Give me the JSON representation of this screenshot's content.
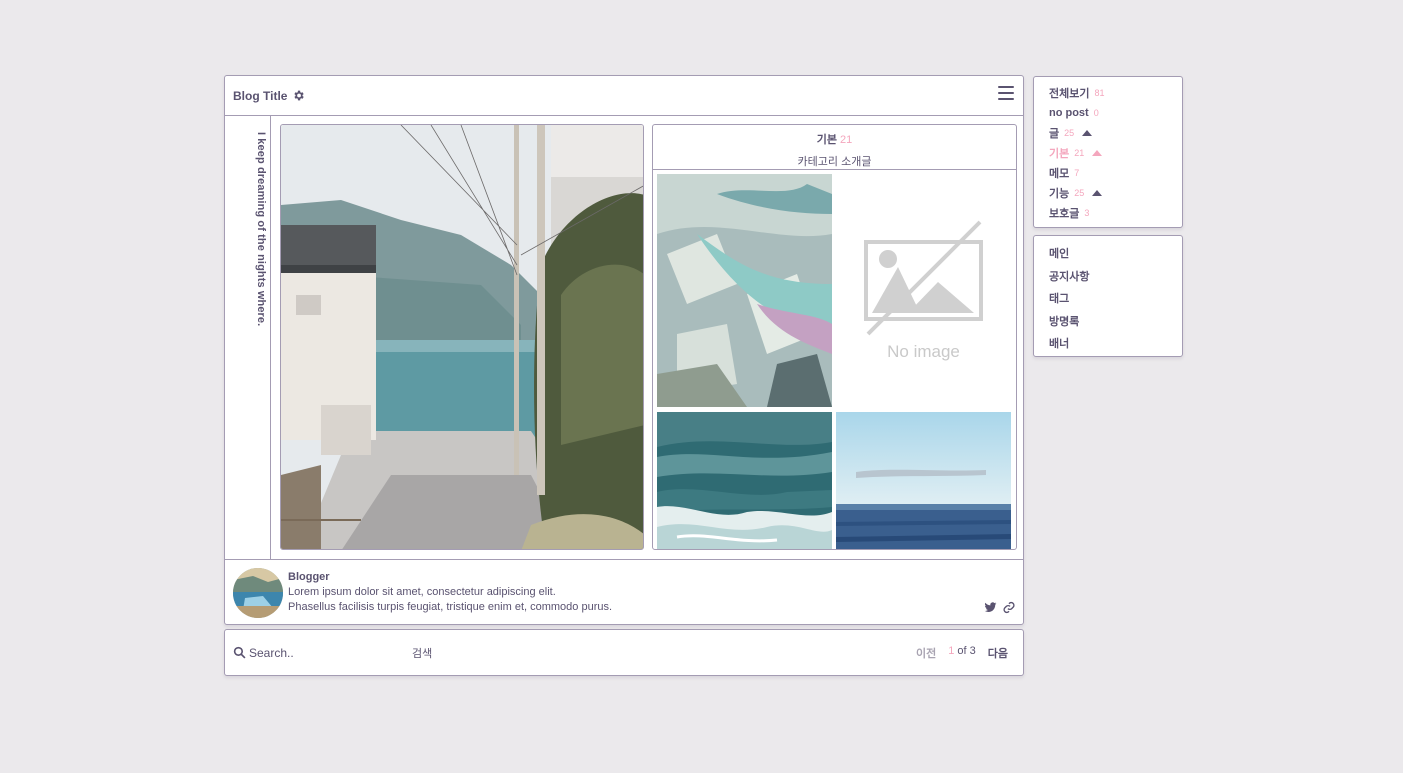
{
  "header": {
    "title": "Blog Title"
  },
  "sidebar_text": "I keep dreaming of the nights where.",
  "featured_category": {
    "name": "기본",
    "count": "21",
    "description": "카테고리 소개글"
  },
  "no_image_text": "No image",
  "profile": {
    "name": "Blogger",
    "bio_line1": "Lorem ipsum dolor sit amet, consectetur adipiscing elit.",
    "bio_line2": "Phasellus facilisis turpis feugiat, tristique enim et, commodo purus."
  },
  "search": {
    "placeholder": "Search..",
    "button_label": "검색"
  },
  "pagination": {
    "prev": "이전",
    "current": "1",
    "of_label": "of 3",
    "next": "다음"
  },
  "categories": [
    {
      "label": "전체보기",
      "count": "81"
    },
    {
      "label": "no post",
      "count": "0"
    },
    {
      "label": "글",
      "count": "25"
    },
    {
      "label": "기본",
      "count": "21"
    },
    {
      "label": "메모",
      "count": "7"
    },
    {
      "label": "기능",
      "count": "25"
    },
    {
      "label": "보호글",
      "count": "3"
    }
  ],
  "nav": [
    "메인",
    "공지사항",
    "태그",
    "방명록",
    "배너"
  ],
  "colors": {
    "accent": "#f4a6bd",
    "text": "#5a5370",
    "border": "#a49cb3",
    "background": "#ebe9ec"
  }
}
